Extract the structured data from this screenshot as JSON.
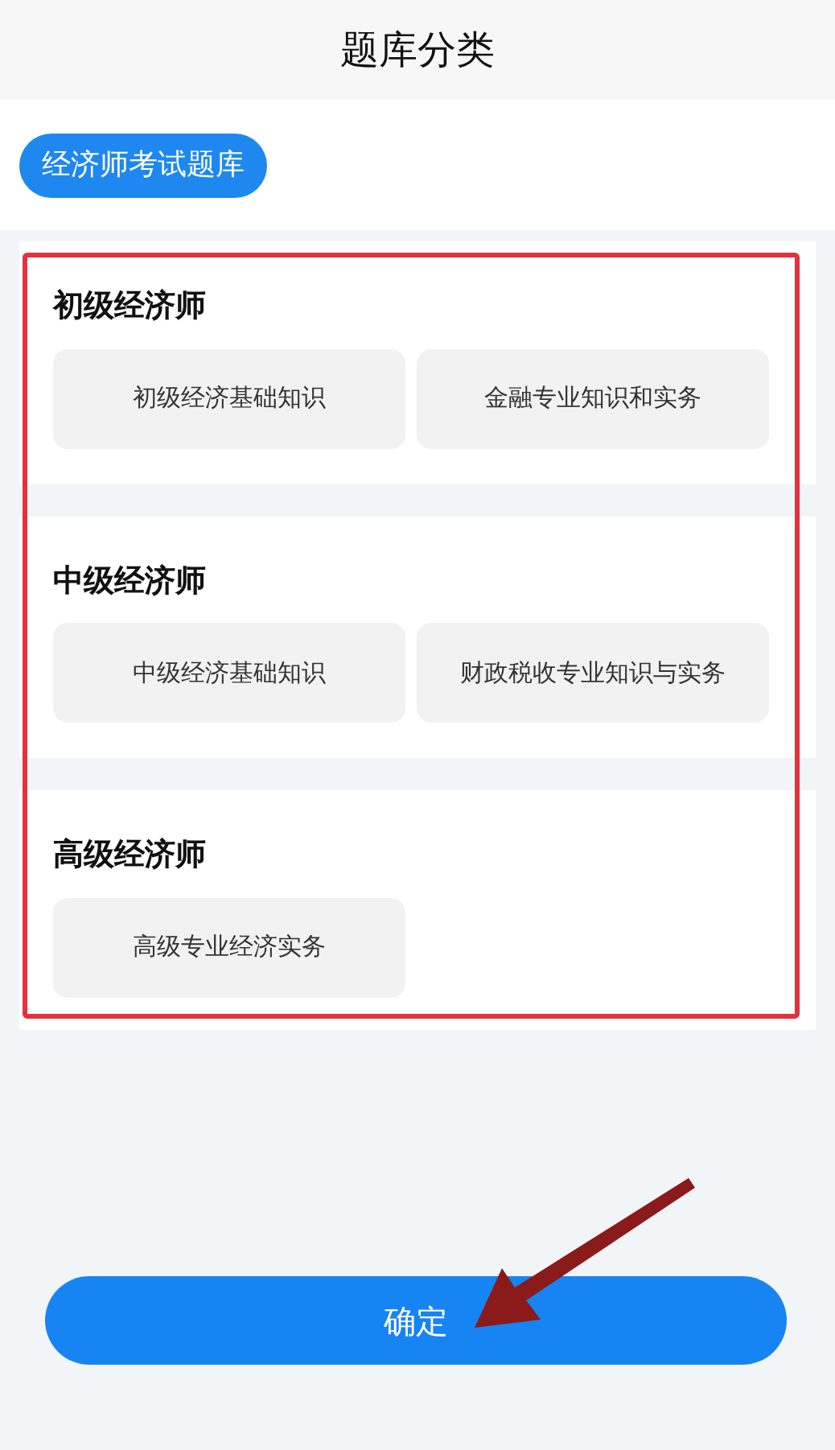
{
  "header": {
    "title": "题库分类"
  },
  "tabs": [
    {
      "label": "经济师考试题库",
      "selected": true
    }
  ],
  "groups": [
    {
      "title": "初级经济师",
      "options": [
        "初级经济基础知识",
        "金融专业知识和实务"
      ]
    },
    {
      "title": "中级经济师",
      "options": [
        "中级经济基础知识",
        "财政税收专业知识与实务"
      ]
    },
    {
      "title": "高级经济师",
      "options": [
        "高级专业经济实务"
      ]
    }
  ],
  "confirm_button": "确定"
}
